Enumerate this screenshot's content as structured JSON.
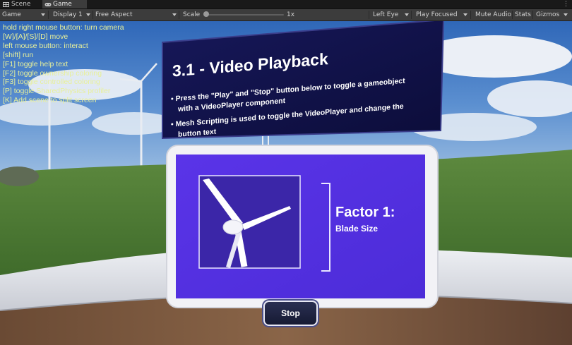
{
  "tabs": [
    {
      "label": "Scene",
      "icon": "scene-grid-icon",
      "active": false
    },
    {
      "label": "Game",
      "icon": "gamepad-icon",
      "active": true
    }
  ],
  "toolbar": {
    "game_view": "Game",
    "display": "Display 1",
    "aspect": "Free Aspect",
    "scale_label": "Scale",
    "scale_value": "1x",
    "eye": "Left Eye",
    "play_mode": "Play Focused",
    "mute_audio": "Mute Audio",
    "stats": "Stats",
    "gizmos": "Gizmos"
  },
  "help_lines": [
    "hold right mouse button: turn camera",
    "[W]/[A]/[S]/[D] move",
    "left mouse button: interact",
    "[shift] run",
    "[F1] toggle help text",
    "[F2] toggle ownership coloring",
    "[F3] toggle controlled coloring",
    "[P] toggle SharedPhysics profiler",
    "[K] Add scene to split screen"
  ],
  "info_panel": {
    "title": "3.1 - Video Playback",
    "bullet_1_line_1": "Press the \"Play\" and \"Stop\" button below to toggle a gameobject",
    "bullet_1_line_2": "with a VideoPlayer component",
    "bullet_2_line_1": "Mesh Scripting is used to toggle the VideoPlayer and change the",
    "bullet_2_line_2": "button text"
  },
  "video": {
    "heading": "Factor 1:",
    "subheading": "Blade Size"
  },
  "stop_button": "Stop",
  "colors": {
    "helptext": "#e8f09a",
    "panel_navy": "#12134a",
    "video_purple": "#5b33e6",
    "turbine_bg": "#3d2aa6"
  }
}
